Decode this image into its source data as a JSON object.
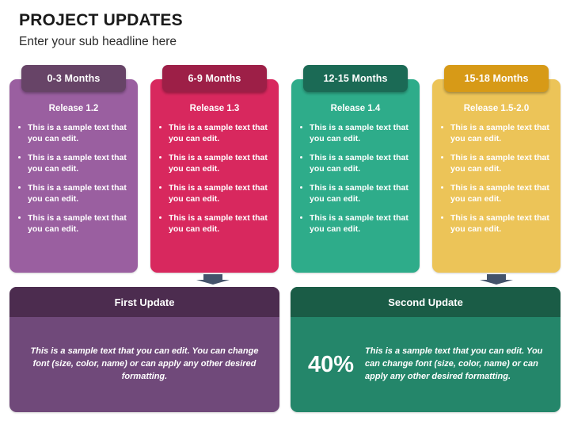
{
  "header": {
    "title": "PROJECT UPDATES",
    "subtitle": "Enter your sub headline here"
  },
  "timeline": {
    "columns": [
      {
        "tab_label": "0-3 Months",
        "release_label": "Release 1.2",
        "tab_color": "#674467",
        "body_color": "#9a5fa0",
        "bullets": [
          "This is a sample text that you can edit.",
          "This is a sample text that you can edit.",
          "This is a sample text that you can edit.",
          "This is a sample text that you can edit."
        ]
      },
      {
        "tab_label": "6-9 Months",
        "release_label": "Release 1.3",
        "tab_color": "#9d1f47",
        "body_color": "#d8285e",
        "bullets": [
          "This is a sample text that you can edit.",
          "This is a sample text that you can edit.",
          "This is a sample text that you can edit.",
          "This is a sample text that you can edit."
        ]
      },
      {
        "tab_label": "12-15 Months",
        "release_label": "Release 1.4",
        "tab_color": "#1b6a55",
        "body_color": "#2eac8a",
        "bullets": [
          "This is a sample text that you can edit.",
          "This is a sample text that you can edit.",
          "This is a sample text that you can edit.",
          "This is a sample text that you can edit."
        ]
      },
      {
        "tab_label": "15-18 Months",
        "release_label": "Release 1.5-2.0",
        "tab_color": "#d79a17",
        "body_color": "#ecc458",
        "bullets": [
          "This is a sample text that you can edit.",
          "This is a sample text that you can edit.",
          "This is a sample text that you can edit.",
          "This is a sample text that you can edit."
        ]
      }
    ]
  },
  "connectors": {
    "arrow_color": "#44536b",
    "icon_left": "down-arrow-icon",
    "icon_right": "down-arrow-icon"
  },
  "updates": [
    {
      "title": "First Update",
      "head_color": "#4c2c4f",
      "body_color": "#70497a",
      "metric": "",
      "text": "This is a sample text that you can edit. You can change font (size, color, name) or can apply any other desired formatting."
    },
    {
      "title": "Second Update",
      "head_color": "#1a5c46",
      "body_color": "#24866a",
      "metric": "40%",
      "text": "This is a sample text that you can edit. You can change font (size, color, name) or can apply any other desired formatting."
    }
  ]
}
